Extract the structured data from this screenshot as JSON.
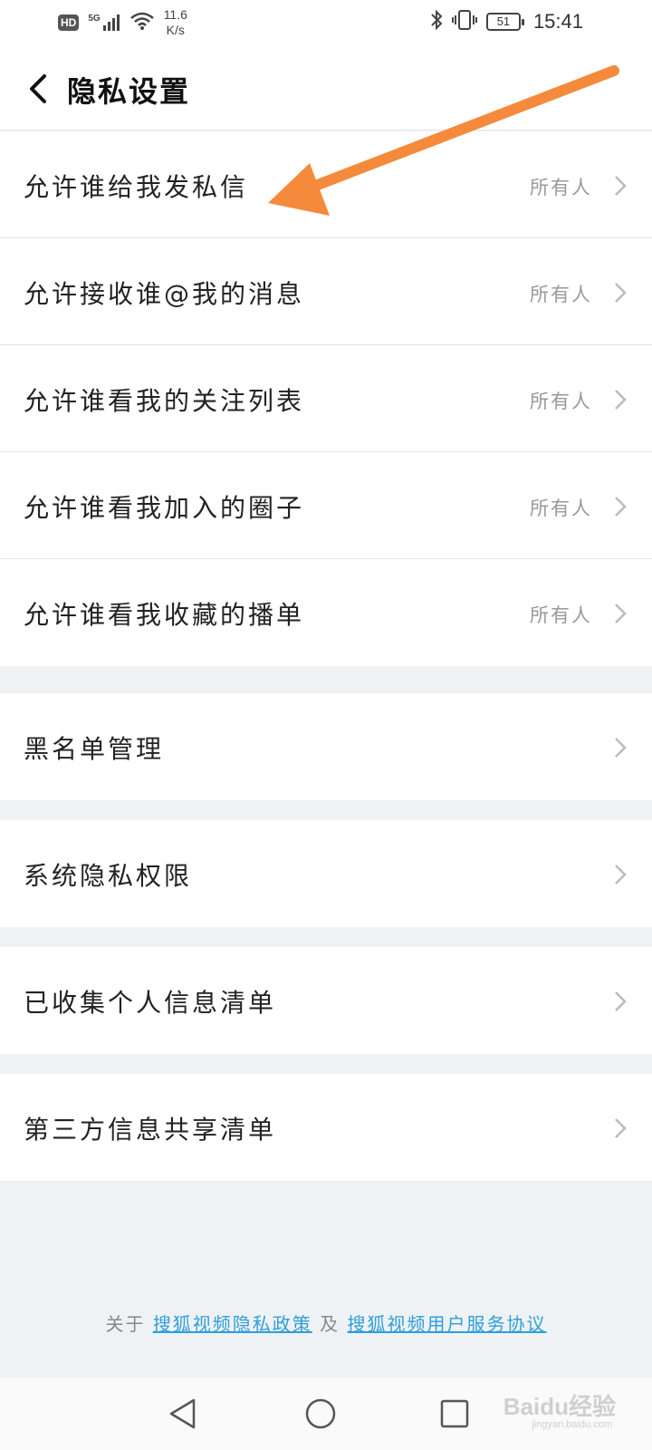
{
  "status_bar": {
    "network": "HD",
    "signal": "5G",
    "speed_value": "11.6",
    "speed_unit": "K/s",
    "battery": "51",
    "time": "15:41"
  },
  "header": {
    "title": "隐私设置"
  },
  "privacy_items": [
    {
      "label": "允许谁给我发私信",
      "value": "所有人"
    },
    {
      "label": "允许接收谁@我的消息",
      "value": "所有人"
    },
    {
      "label": "允许谁看我的关注列表",
      "value": "所有人"
    },
    {
      "label": "允许谁看我加入的圈子",
      "value": "所有人"
    },
    {
      "label": "允许谁看我收藏的播单",
      "value": "所有人"
    }
  ],
  "other_items": [
    {
      "label": "黑名单管理"
    },
    {
      "label": "系统隐私权限"
    },
    {
      "label": "已收集个人信息清单"
    },
    {
      "label": "第三方信息共享清单"
    }
  ],
  "footer": {
    "prefix": "关于",
    "privacy_policy_link": "搜狐视频隐私政策",
    "conjunction": "及",
    "user_agreement_link": "搜狐视频用户服务协议"
  },
  "watermark": {
    "brand": "Baidu经验",
    "url": "jingyan.baidu.com"
  },
  "colors": {
    "annotation_arrow": "#f58a3c",
    "link": "#2d9fd8",
    "page_background": "#eff2f5"
  }
}
